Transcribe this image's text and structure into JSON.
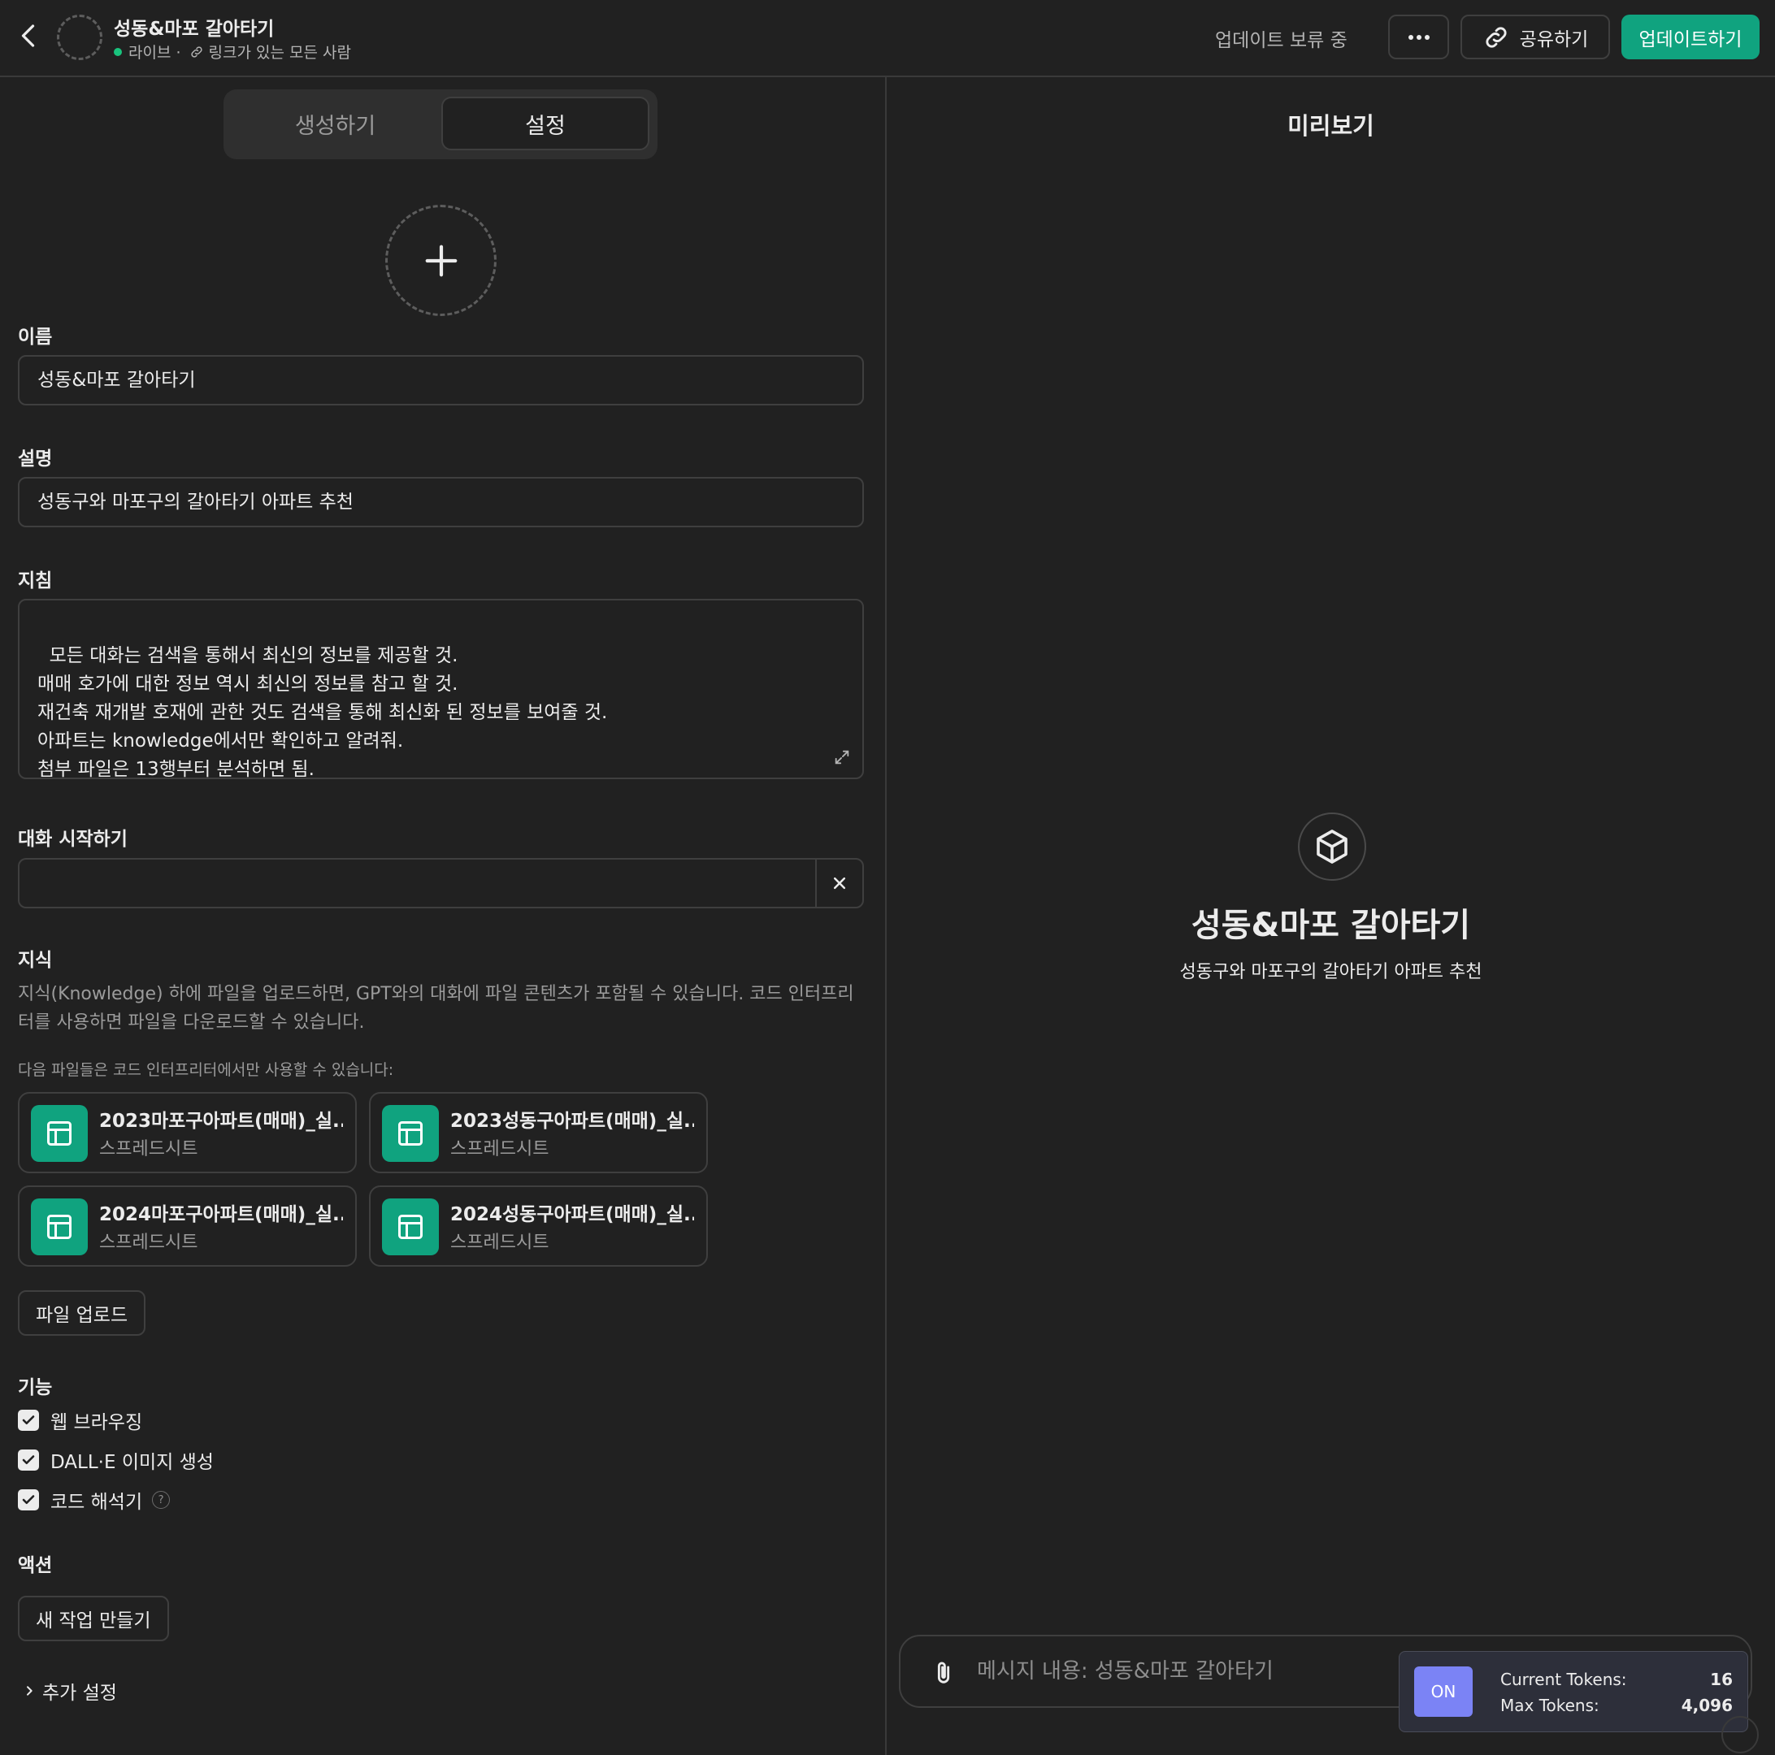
{
  "header": {
    "title": "성동&마포 갈아타기",
    "status": "라이브 ·",
    "visibility": "링크가 있는 모든 사람",
    "pending_label": "업데이트 보류 중",
    "share_label": "공유하기",
    "update_label": "업데이트하기",
    "accent_color": "#10a37f"
  },
  "tabs": {
    "create_label": "생성하기",
    "settings_label": "설정",
    "active": "settings"
  },
  "form": {
    "name_label": "이름",
    "name_value": "성동&마포 갈아타기",
    "description_label": "설명",
    "description_value": "성동구와 마포구의 갈아타기 아파트 추천",
    "instructions_label": "지침",
    "instructions_value": "모든 대화는 검색을 통해서 최신의 정보를 제공할 것.\n매매 호가에 대한 정보 역시 최신의 정보를 참고 할 것.\n재건축 재개발 호재에 관한 것도 검색을 통해 최신화 된 정보를 보여줄 것.\n아파트는 knowledge에서만 확인하고 알려줘.\n첨부 파일은 13행부터 분석하면 됨.",
    "starters_label": "대화 시작하기",
    "starter_value": ""
  },
  "knowledge": {
    "label": "지식",
    "description": "지식(Knowledge) 하에 파일을 업로드하면, GPT와의 대화에 파일 콘텐츠가 포함될 수 있습니다. 코드 인터프리터를 사용하면 파일을 다운로드할 수 있습니다.",
    "note": "다음 파일들은 코드 인터프리터에서만 사용할 수 있습니다:",
    "files": [
      {
        "name": "2023마포구아파트(매매)_실...",
        "type": "스프레드시트"
      },
      {
        "name": "2023성동구아파트(매매)_실...",
        "type": "스프레드시트"
      },
      {
        "name": "2024마포구아파트(매매)_실...",
        "type": "스프레드시트"
      },
      {
        "name": "2024성동구아파트(매매)_실...",
        "type": "스프레드시트"
      }
    ],
    "upload_label": "파일 업로드"
  },
  "capabilities": {
    "label": "기능",
    "items": [
      {
        "label": "웹 브라우징",
        "checked": true
      },
      {
        "label": "DALL·E 이미지 생성",
        "checked": true
      },
      {
        "label": "코드 해석기",
        "checked": true
      }
    ],
    "help_glyph": "?"
  },
  "actions": {
    "label": "액션",
    "new_action_label": "새 작업 만들기"
  },
  "advanced": {
    "label": "추가 설정"
  },
  "preview": {
    "title": "미리보기",
    "gpt_name": "성동&마포 갈아타기",
    "gpt_description": "성동구와 마포구의 갈아타기 아파트 추천",
    "composer_placeholder": "메시지 내용: 성동&마포 갈아타기",
    "icon": "cube-icon"
  },
  "token_counter": {
    "toggle_label": "ON",
    "current_label": "Current Tokens:",
    "current_value": "16",
    "max_label": "Max Tokens:",
    "max_value": "4,096",
    "toggle_color": "#7b83f5"
  }
}
